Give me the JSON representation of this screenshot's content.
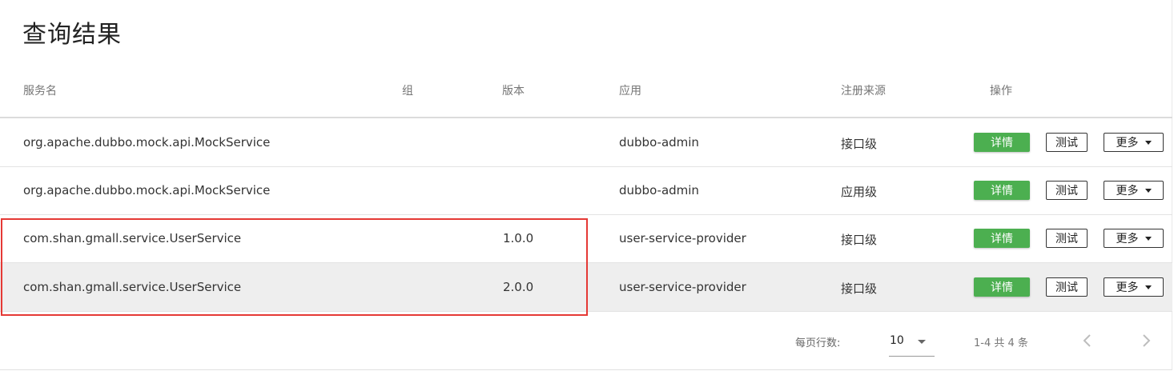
{
  "title": "查询结果",
  "columns": {
    "service": "服务名",
    "group": "组",
    "version": "版本",
    "app": "应用",
    "source": "注册来源",
    "ops": "操作"
  },
  "rows": [
    {
      "service": "org.apache.dubbo.mock.api.MockService",
      "group": "",
      "version": "",
      "app": "dubbo-admin",
      "source": "接口级"
    },
    {
      "service": "org.apache.dubbo.mock.api.MockService",
      "group": "",
      "version": "",
      "app": "dubbo-admin",
      "source": "应用级"
    },
    {
      "service": "com.shan.gmall.service.UserService",
      "group": "",
      "version": "1.0.0",
      "app": "user-service-provider",
      "source": "接口级"
    },
    {
      "service": "com.shan.gmall.service.UserService",
      "group": "",
      "version": "2.0.0",
      "app": "user-service-provider",
      "source": "接口级"
    }
  ],
  "actions": {
    "detail": "详情",
    "test": "测试",
    "more": "更多"
  },
  "pagination": {
    "rows_per_page_label": "每页行数:",
    "rows_per_page": "10",
    "range": "1-4 共 4 条"
  },
  "colors": {
    "detail_button": "#4caf50",
    "highlight_row": "#eeeeee",
    "annotation_box": "#e53935"
  }
}
